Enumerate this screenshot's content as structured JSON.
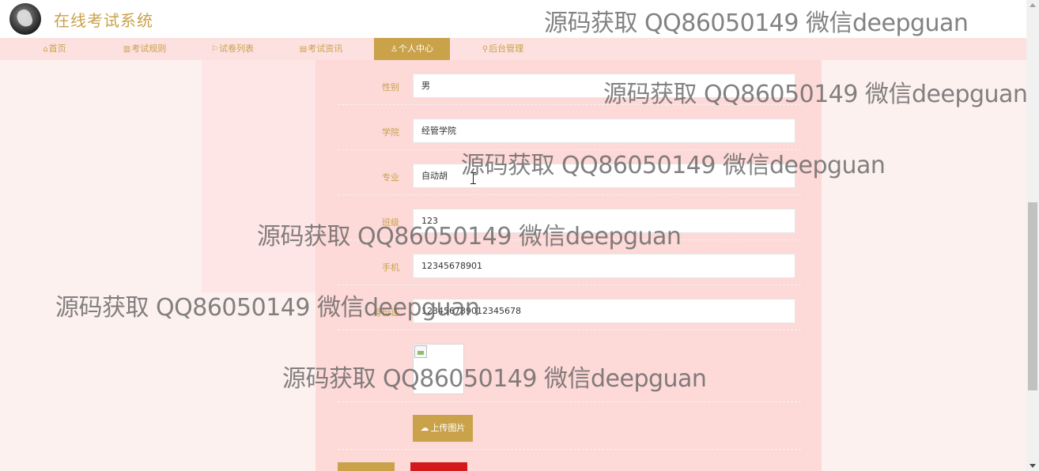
{
  "header": {
    "site_title": "在线考试系统",
    "logo_icon": "bird-logo-icon"
  },
  "nav": {
    "items": [
      {
        "icon": "home-icon",
        "glyph": "⌂",
        "label": "首页",
        "active": false
      },
      {
        "icon": "book-icon",
        "glyph": "▥",
        "label": "考试规则",
        "active": false
      },
      {
        "icon": "flag-icon",
        "glyph": "⚐",
        "label": "试卷列表",
        "active": false
      },
      {
        "icon": "news-icon",
        "glyph": "▤",
        "label": "考试资讯",
        "active": false
      },
      {
        "icon": "user-icon",
        "glyph": "♙",
        "label": "个人中心",
        "active": true
      },
      {
        "icon": "link-icon",
        "glyph": "⚲",
        "label": "后台管理",
        "active": false
      }
    ],
    "active_color": "#c9a24a",
    "bar_color": "#fde0e0"
  },
  "form": {
    "fields": [
      {
        "label": "性别",
        "value": "男"
      },
      {
        "label": "学院",
        "value": "经管学院"
      },
      {
        "label": "专业",
        "value": "自动胡"
      },
      {
        "label": "班级",
        "value": "123"
      },
      {
        "label": "手机",
        "value": "12345678901"
      },
      {
        "label": "身份证",
        "value": "123456789012345678"
      }
    ],
    "upload_label": "上传图片",
    "upload_icon": "cloud-upload-icon"
  },
  "watermark": {
    "text": "源码获取 QQ86050149 微信deepguan"
  },
  "colors": {
    "accent": "#c9a24a",
    "danger": "#d3191c",
    "panel": "#fdd9d8",
    "page_bg": "#fdf1f0"
  }
}
